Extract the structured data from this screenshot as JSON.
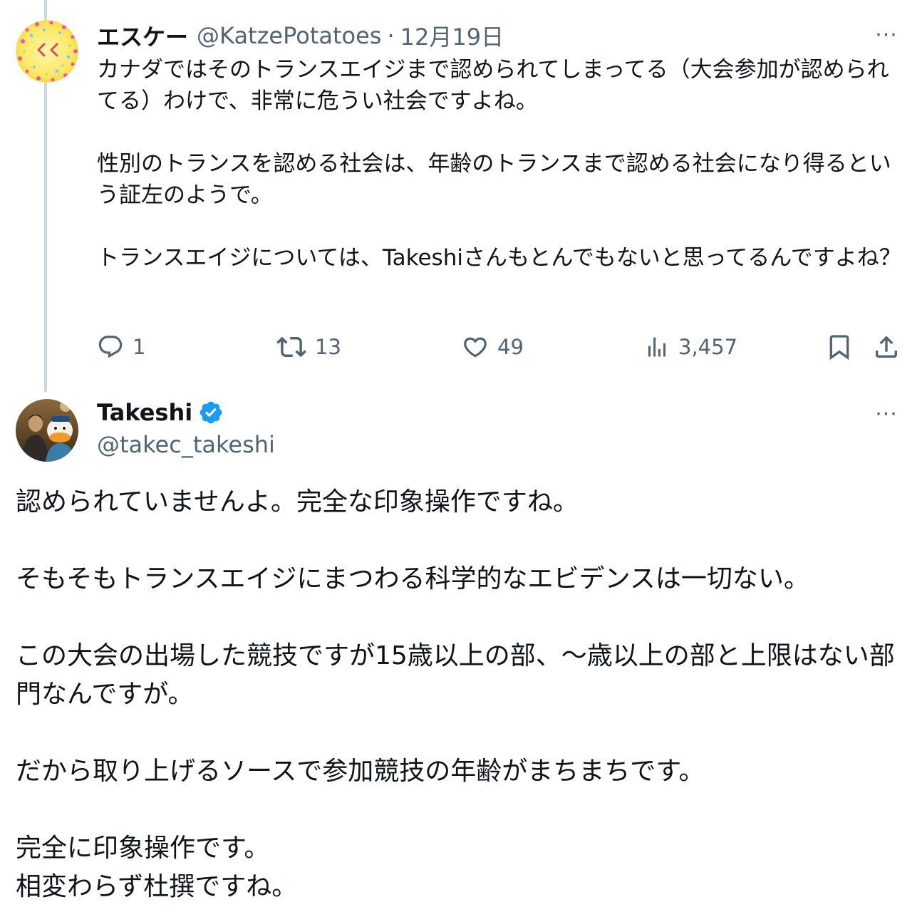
{
  "reply_tweet": {
    "display_name": "エスケー",
    "handle": "@KatzePotatoes",
    "separator": "·",
    "date": "12月19日",
    "more_label": "···",
    "paragraphs": [
      "カナダではそのトランスエイジまで認められてしまってる（大会参加が認められてる）わけで、非常に危うい社会ですよね。",
      "性別のトランスを認める社会は、年齢のトランスまで認める社会になり得るという証左のようで。",
      "トランスエイジについては、Takeshiさんもとんでもないと思ってるんですよね？"
    ],
    "actions": {
      "reply_count": "1",
      "retweet_count": "13",
      "like_count": "49",
      "view_count": "3,457"
    },
    "icons": [
      "reply-icon",
      "retweet-icon",
      "like-icon",
      "views-icon",
      "bookmark-icon",
      "share-icon"
    ]
  },
  "main_tweet": {
    "display_name": "Takeshi",
    "handle": "@takec_takeshi",
    "more_label": "···",
    "verified_color": "#1d9bf0",
    "paragraphs": [
      "認められていませんよ。完全な印象操作ですね。",
      "そもそもトランスエイジにまつわる科学的なエビデンスは一切ない。",
      "この大会の出場した競技ですが15歳以上の部、〜歳以上の部と上限はない部門なんですが。",
      "だから取り上げるソースで参加競技の年齢がまちまちです。",
      "完全に印象操作です。",
      "相変わらず杜撰ですね。"
    ]
  },
  "colors": {
    "text": "#0f1419",
    "secondary": "#536471",
    "thread_line": "#cfd9de",
    "accent": "#1d9bf0"
  }
}
